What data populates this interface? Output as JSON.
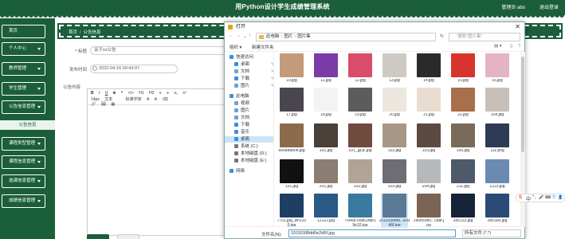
{
  "header": {
    "title": "用Python设计学生成绩管理系统",
    "user": "管理员 abo",
    "logout": "退出登录"
  },
  "sidebar": {
    "items": [
      {
        "label": "首页"
      },
      {
        "label": "个人中心"
      },
      {
        "label": "教师管理"
      },
      {
        "label": "学生管理"
      },
      {
        "label": "公告信息管理"
      },
      {
        "label": "课程类型管理"
      },
      {
        "label": "课程信息管理"
      },
      {
        "label": "选课信息管理"
      },
      {
        "label": "成绩信息管理"
      }
    ],
    "sub_item": "公告信息"
  },
  "breadcrumb": [
    "首页",
    "公告信息"
  ],
  "form": {
    "title_label": "* 标题",
    "title_value": "关于xx公告",
    "time_label": "发布时间",
    "time_value": "2022-04-16 00:43:07",
    "content_label": "公告内容"
  },
  "editor_toolbar": {
    "row1": [
      "B",
      "I",
      "U",
      "S",
      "❝",
      "</>",
      "H1",
      "H2",
      "≡",
      "≡",
      "x₂",
      "x²"
    ],
    "row2": [
      "14px",
      "文本",
      "标准字体",
      "A",
      "A",
      "⌫"
    ],
    "row3": [
      "🔗",
      "🖼",
      "▦"
    ],
    "font_size": "14px",
    "text_style": "文本",
    "font_family": "标准字体"
  },
  "dialog": {
    "title": "打开",
    "close": "✕",
    "path": [
      "此电脑",
      "图片",
      "图片集"
    ],
    "search_placeholder": "搜索\"图片集\"",
    "organize": "组织 ▾",
    "new_folder": "新建文件夹",
    "nav": [
      {
        "label": "快速访问",
        "icon": "star-icon",
        "color": "#3b8fd9"
      },
      {
        "label": "桌面",
        "icon": "desktop-icon",
        "color": "#3b8fd9",
        "pinned": true
      },
      {
        "label": "文档",
        "icon": "document-icon",
        "color": "#6aa3d8",
        "pinned": true
      },
      {
        "label": "下载",
        "icon": "download-icon",
        "color": "#3b8fd9",
        "pinned": true
      },
      {
        "label": "图片",
        "icon": "picture-icon",
        "color": "#6aa3d8",
        "pinned": true
      },
      {
        "label": "此电脑",
        "icon": "pc-icon",
        "color": "#3b8fd9"
      },
      {
        "label": "视频",
        "icon": "video-icon",
        "color": "#6aa3d8"
      },
      {
        "label": "图片",
        "icon": "picture-icon",
        "color": "#6aa3d8"
      },
      {
        "label": "文档",
        "icon": "document-icon",
        "color": "#6aa3d8"
      },
      {
        "label": "下载",
        "icon": "download-icon",
        "color": "#3b8fd9"
      },
      {
        "label": "音乐",
        "icon": "music-icon",
        "color": "#3b8fd9"
      },
      {
        "label": "桌面",
        "icon": "desktop-icon",
        "color": "#3b8fd9",
        "selected": true
      },
      {
        "label": "系统 (C:)",
        "icon": "drive-icon",
        "color": "#777"
      },
      {
        "label": "本地磁盘 (D:)",
        "icon": "drive-icon",
        "color": "#777"
      },
      {
        "label": "本地磁盘 (E:)",
        "icon": "drive-icon",
        "color": "#777"
      },
      {
        "label": "网络",
        "icon": "network-icon",
        "color": "#3b8fd9"
      }
    ],
    "files": [
      {
        "name": "10.jpg",
        "color": "#c39a7a"
      },
      {
        "name": "11.jpg",
        "color": "#7a3ba8"
      },
      {
        "name": "12.jpg",
        "color": "#d94c6a"
      },
      {
        "name": "13.jpg",
        "color": "#cfc9c4"
      },
      {
        "name": "14.jpg",
        "color": "#2a2a2a"
      },
      {
        "name": "15.jpg",
        "color": "#d6342c"
      },
      {
        "name": "16.jpg",
        "color": "#e4b4c2"
      },
      {
        "name": "17.jpg",
        "color": "#4a4650"
      },
      {
        "name": "18.jpg",
        "color": "#f3f3f3"
      },
      {
        "name": "19.jpg",
        "color": "#5c5c5c"
      },
      {
        "name": "20.jpg",
        "color": "#ece6de"
      },
      {
        "name": "21.jpg",
        "color": "#e9ddd0"
      },
      {
        "name": "22.jpg",
        "color": "#a96e4a"
      },
      {
        "name": "104.jpg",
        "color": "#c8c0b8"
      },
      {
        "name": "666888808.jpg",
        "color": "#8c6a4c"
      },
      {
        "name": "101.jpg",
        "color": "#4a4038"
      },
      {
        "name": "101_副本.jpg",
        "color": "#6f4c3e"
      },
      {
        "name": "102.jpg",
        "color": "#a89686"
      },
      {
        "name": "103.jpg",
        "color": "#5b4a42"
      },
      {
        "name": "106.jpg",
        "color": "#7a6a5a"
      },
      {
        "name": "111.png",
        "color": "#2e3a56"
      },
      {
        "name": "121.jpg",
        "color": "#111"
      },
      {
        "name": "201.jpg",
        "color": "#8a7e74"
      },
      {
        "name": "202.jpg",
        "color": "#b0a496"
      },
      {
        "name": "203.jpg",
        "color": "#6e6c74"
      },
      {
        "name": "204.jpg",
        "color": "#b6b9bc"
      },
      {
        "name": "211.jpg",
        "color": "#4e5a6a"
      },
      {
        "name": "1223.jpg",
        "color": "#6a8ab0"
      },
      {
        "name": "7701.jpg_wh1200.jpg",
        "color": "#1e3e64"
      },
      {
        "name": "12122.jpg",
        "color": "#2a5a86"
      },
      {
        "name": "75468-55d62fab19e10.jpg",
        "color": "#3a7a9e"
      },
      {
        "name": "1019158fdd...e33d6f.jpg",
        "color": "#5a7a96",
        "selected": true
      },
      {
        "name": "290850b5...cdaf.jpg",
        "color": "#7a6454"
      },
      {
        "name": "285133.jpg",
        "color": "#16243a"
      },
      {
        "name": "285300.jpg",
        "color": "#2b4a78"
      }
    ],
    "filename_label": "文件名(N):",
    "filename_value": "1019158fdd0e2d6f.jpg",
    "filetype_value": "所有文件 (*.*)"
  },
  "ime": [
    "S",
    "中",
    "°,",
    "🎤",
    "⌨",
    "👕",
    "👤"
  ],
  "colors": {
    "brand": "#1b5e3a",
    "selection": "#cce4f7"
  }
}
